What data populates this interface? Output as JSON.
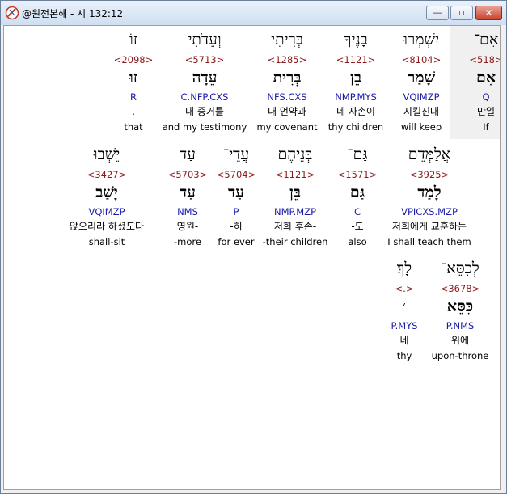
{
  "window": {
    "title": "@원전본해 - 시 132:12",
    "minimize_glyph": "—",
    "maximize_glyph": "▫",
    "close_glyph": "✕"
  },
  "verse_rows": [
    [
      {
        "hebrew": "אִם־",
        "strong": "<518>",
        "lemma": "אִם",
        "morph": "Q",
        "korean": "만일",
        "english": "If"
      },
      {
        "hebrew": "יִשְׁמְרוּ",
        "strong": "<8104>",
        "lemma": "שָׁמַר",
        "morph": "VQIMZP",
        "korean": "지킬진대",
        "english": "will keep"
      },
      {
        "hebrew": "בָנֶיךָ",
        "strong": "<1121>",
        "lemma": "בֵּן",
        "morph": "NMP.MYS",
        "korean": "네 자손이",
        "english": "thy children"
      },
      {
        "hebrew": "בְּרִיתִי",
        "strong": "<1285>",
        "lemma": "בְּרִית",
        "morph": "NFS.CXS",
        "korean": "내 언약과",
        "english": "my covenant"
      },
      {
        "hebrew": "וְעֵדֹתִי",
        "strong": "<5713>",
        "lemma": "עֵדָה",
        "morph": "C.NFP.CXS",
        "korean": "내 증거를",
        "english": "and my testimony"
      },
      {
        "hebrew": "זוֹ",
        "strong": "<2098>",
        "lemma": "זוּ",
        "morph": "R",
        "korean": ".",
        "english": "that"
      }
    ],
    [
      {
        "hebrew": "אֲלַמְּדֵם",
        "strong": "<3925>",
        "lemma": "לָמַד",
        "morph": "VPICXS.MZP",
        "korean": "저희에게 교훈하는",
        "english": "I shall teach them"
      },
      {
        "hebrew": "גַּם־",
        "strong": "<1571>",
        "lemma": "גַּם",
        "morph": "C",
        "korean": "-도",
        "english": "also"
      },
      {
        "hebrew": "בְּנֵיהֶם",
        "strong": "<1121>",
        "lemma": "בֵּן",
        "morph": "NMP.MZP",
        "korean": "저희 후손-",
        "english": "-their children"
      },
      {
        "hebrew": "עֲדֵי־",
        "strong": "<5704>",
        "lemma": "עַד",
        "morph": "P",
        "korean": "-히",
        "english": "for ever"
      },
      {
        "hebrew": "עַד",
        "strong": "<5703>",
        "lemma": "עַד",
        "morph": "NMS",
        "korean": "영원-",
        "english": "-more"
      },
      {
        "hebrew": "יֵשְׁבוּ",
        "strong": "<3427>",
        "lemma": "יָשַׁב",
        "morph": "VQIMZP",
        "korean": "앉으리라 하셨도다",
        "english": "shall-sit"
      }
    ],
    [
      {
        "hebrew": "לְכִסֵּא־",
        "strong": "<3678>",
        "lemma": "כִּסֵּא",
        "morph": "P.NMS",
        "korean": "위에",
        "english": "upon-throne"
      },
      {
        "hebrew": "לָךְ׃",
        "strong": "<.>",
        "lemma": "׳",
        "morph": "P.MYS",
        "korean": "네",
        "english": "thy"
      }
    ]
  ]
}
